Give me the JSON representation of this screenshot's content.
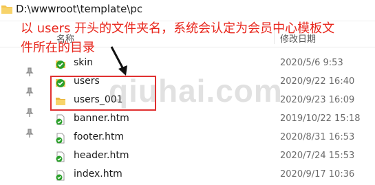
{
  "path": {
    "text": "D:\\wwwroot\\template\\pc"
  },
  "header": {
    "name": "名称",
    "modified": "修改日期"
  },
  "files": [
    {
      "name": "skin",
      "date": "2020/5/6 9:53",
      "type": "folder-sync"
    },
    {
      "name": "users",
      "date": "2020/9/22 16:40",
      "type": "folder-sync"
    },
    {
      "name": "users_001",
      "date": "2020/9/23 16:09",
      "type": "folder"
    },
    {
      "name": "banner.htm",
      "date": "2019/10/22 15:18",
      "type": "file-sync"
    },
    {
      "name": "footer.htm",
      "date": "2020/8/31 16:53",
      "type": "file-sync"
    },
    {
      "name": "header.htm",
      "date": "2020/7/24 15:53",
      "type": "file-sync"
    },
    {
      "name": "index.htm",
      "date": "2020/9/17 10:36",
      "type": "file-sync"
    }
  ],
  "annotation": {
    "line1": "以 users 开头的文件夹名，系统会认定为会员中心模板文",
    "line2": "件所在的目录"
  },
  "watermark": "qiuhai.com",
  "colors": {
    "annotation": "#e8261c",
    "highlight": "#e03030",
    "sync": "#2aa02a",
    "folder": "#f3c44f"
  }
}
